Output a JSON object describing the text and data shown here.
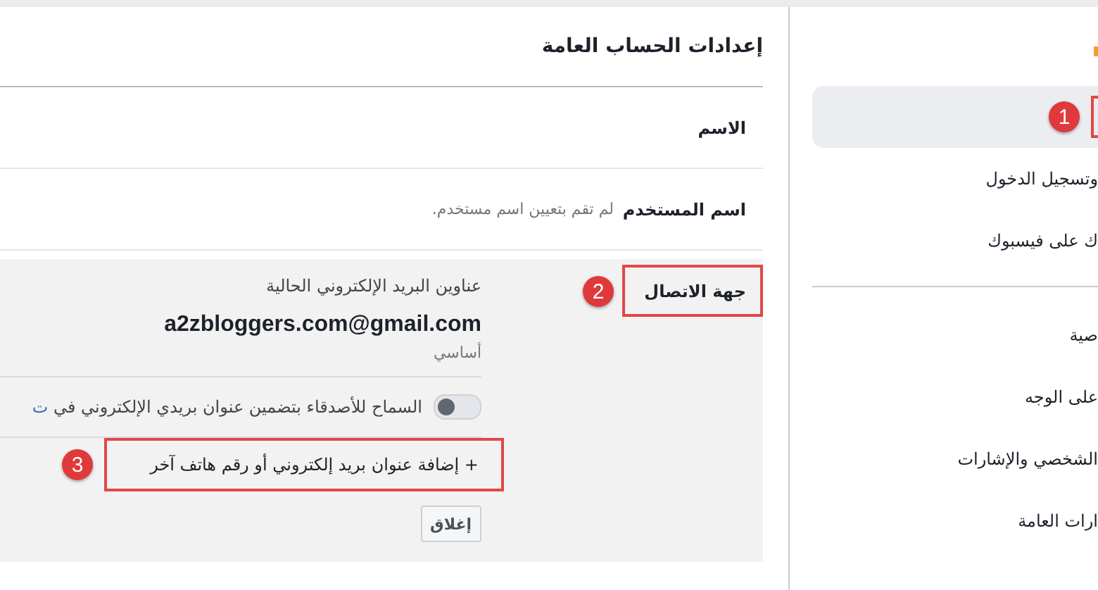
{
  "sidebar": {
    "groups": [
      [
        {
          "selected": true,
          "marker": "1"
        },
        {
          "label": "وتسجيل الدخول",
          "selected": false
        },
        {
          "label": "ك على فيسبوك",
          "selected": false
        }
      ],
      [
        {
          "label": "صية",
          "selected": false
        },
        {
          "label": "على الوجه",
          "selected": false
        },
        {
          "label": "الشخصي والإشارات",
          "selected": false
        },
        {
          "label": "ارات العامة",
          "selected": false
        }
      ]
    ]
  },
  "main": {
    "title": "إعدادات الحساب العامة",
    "rows": [
      {
        "label": "الاسم"
      },
      {
        "label": "اسم المستخدم",
        "value": "لم تقم بتعيين اسم مستخدم."
      }
    ],
    "contact": {
      "label": "جهة الاتصال",
      "marker": "2",
      "heading": "عناوين البريد الإلكتروني الحالية",
      "email": "a2zbloggers.com@gmail.com",
      "email_note": "أساسي",
      "toggle": {
        "on": false,
        "text": "السماح للأصدقاء بتضمين عنوان بريدي الإلكتروني في",
        "link": "ت"
      },
      "add_link": {
        "label": "+ إضافة عنوان بريد إلكتروني أو رقم هاتف آخر",
        "marker": "3"
      },
      "close_button": "إغلاق"
    }
  }
}
